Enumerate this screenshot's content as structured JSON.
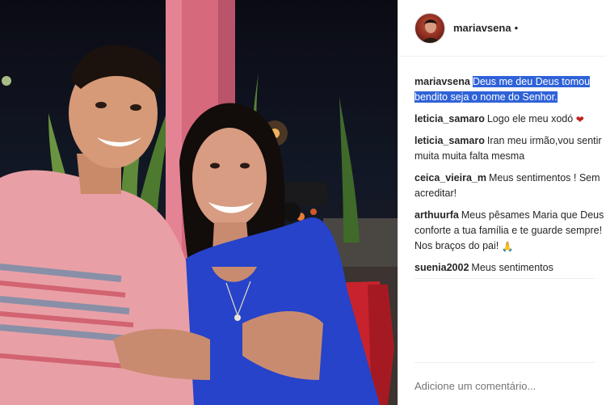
{
  "post": {
    "username": "mariavsena",
    "header_dot": "•",
    "caption": {
      "username": "mariavsena",
      "text": "Deus me deu Deus tomou bendito seja o nome do Senhor."
    },
    "comments": [
      {
        "username": "leticia_samaro",
        "text": "Logo ele meu xodó",
        "emoji": "❤"
      },
      {
        "username": "leticia_samaro",
        "text": "Iran meu irmão,vou sentir muita muita falta mesma"
      },
      {
        "username": "ceica_vieira_m",
        "text": "Meus sentimentos ! Sem acreditar!"
      },
      {
        "username": "arthuurfa",
        "text": "Meus pêsames Maria que Deus conforte a tua família e te guarde sempre! Nos braços do pai!",
        "emoji": "🙏"
      },
      {
        "username": "suenia2002",
        "text": "Meus sentimentos"
      }
    ],
    "add_comment_placeholder": "Adicione um comentário...",
    "caption_highlight_color": "#2f62d8",
    "heart_color": "#c0201a"
  }
}
